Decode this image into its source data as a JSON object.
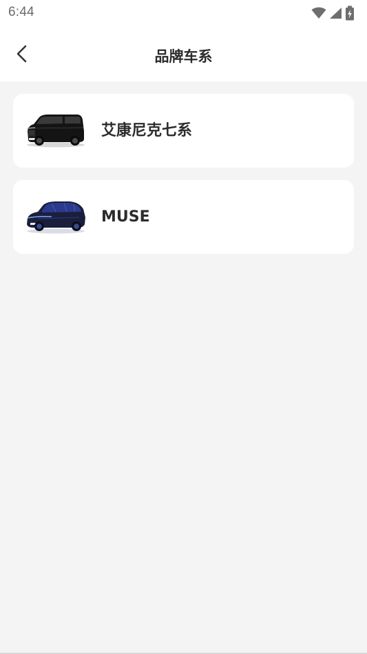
{
  "status_bar": {
    "time": "6:44",
    "icons": [
      "wifi-icon",
      "cell-signal-icon",
      "battery-charging-icon"
    ]
  },
  "header": {
    "title": "品牌车系",
    "back_icon": "chevron-left-icon"
  },
  "series": [
    {
      "name": "艾康尼克七系",
      "image": "black-mpv-car-image"
    },
    {
      "name": "MUSE",
      "image": "blue-concept-car-image"
    }
  ],
  "colors": {
    "page_background": "#f4f4f4",
    "card_background": "#ffffff",
    "title_text": "#2b2b2b",
    "status_icons": "#6e6e6e"
  }
}
